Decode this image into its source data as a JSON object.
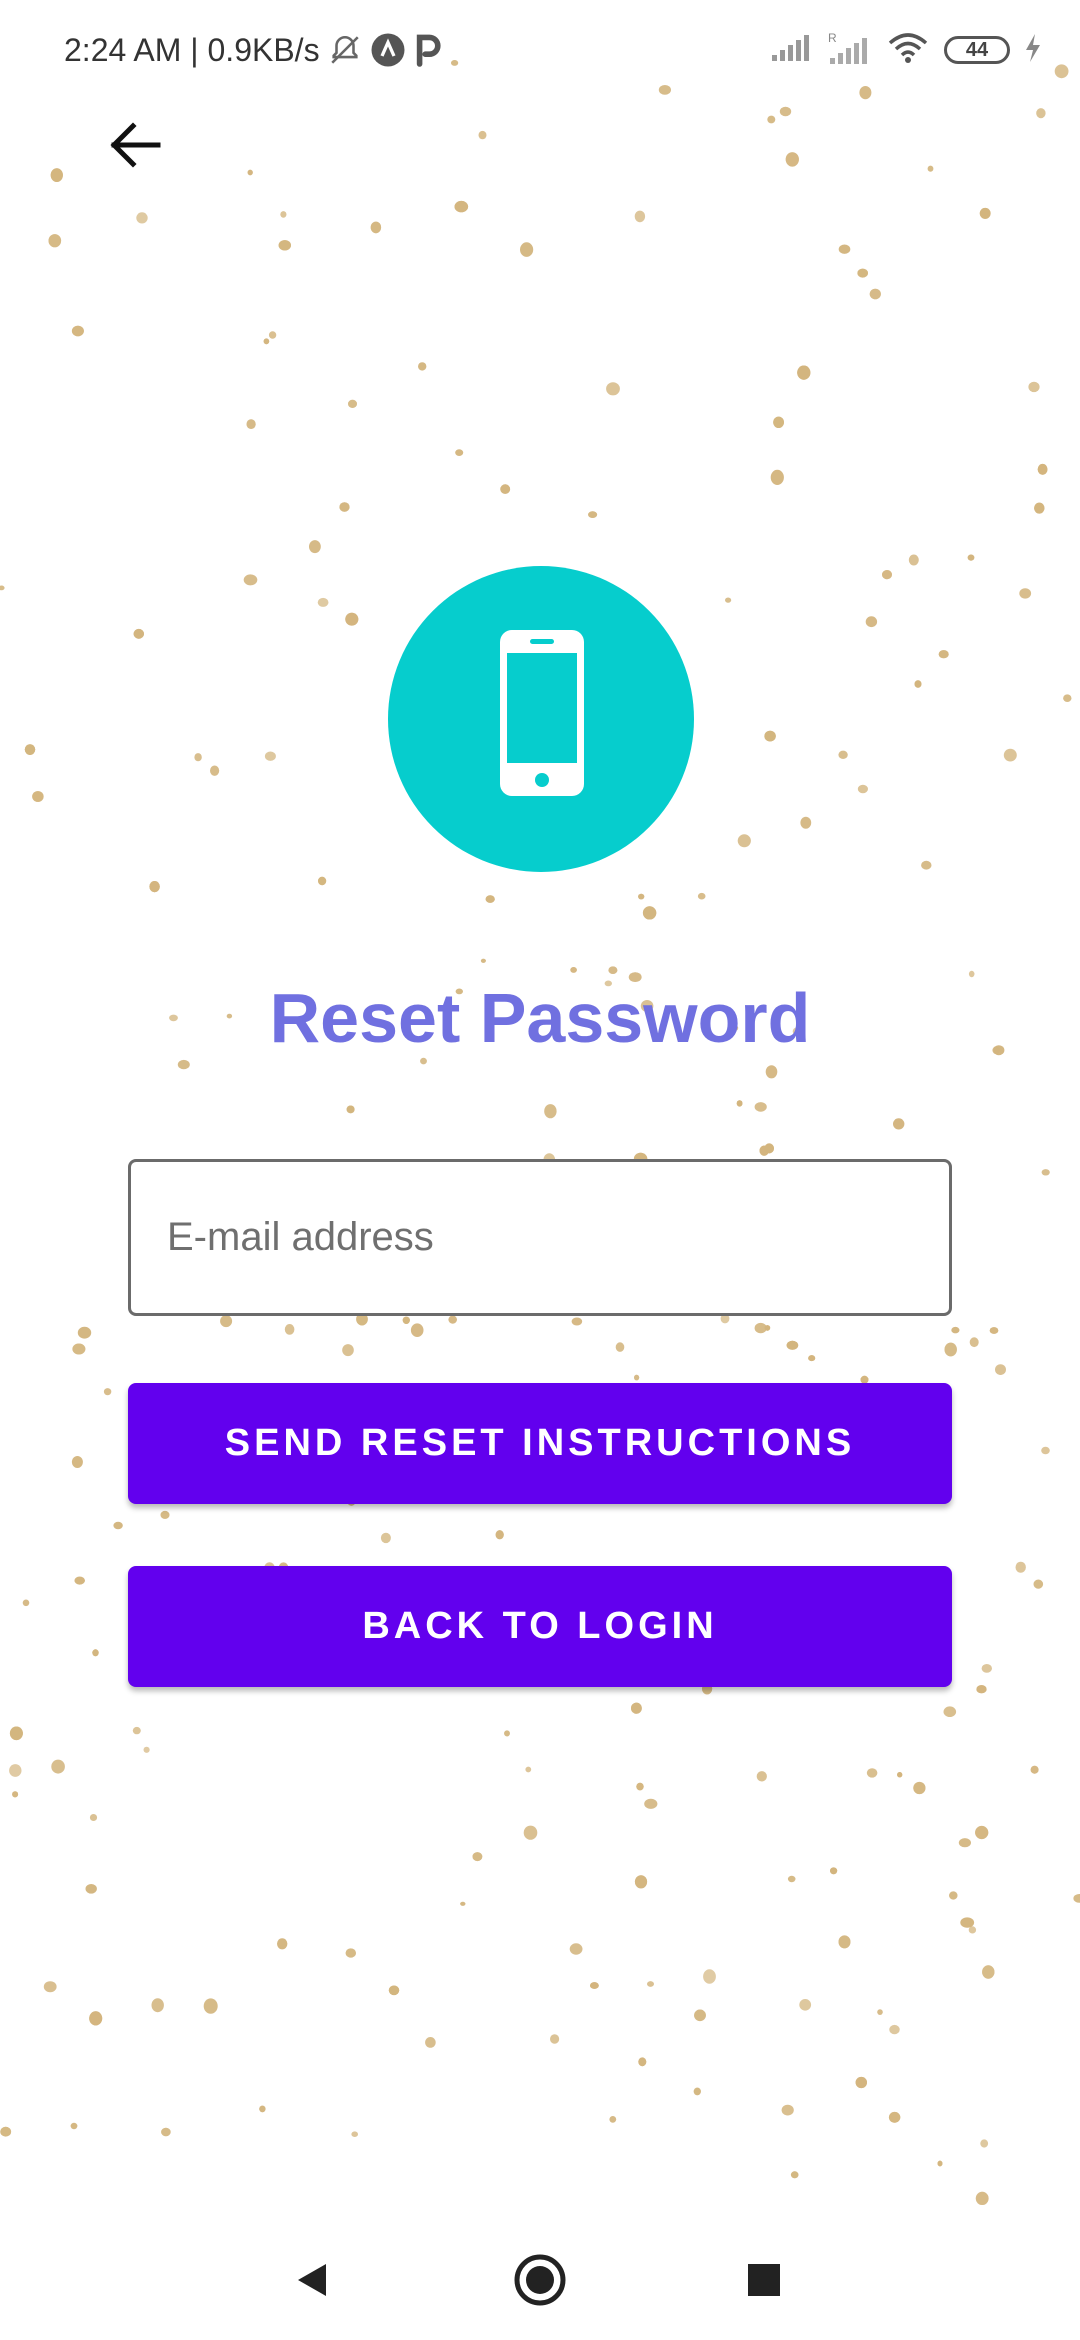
{
  "status_bar": {
    "time_speed": "2:24 AM | 0.9KB/s",
    "battery": "44",
    "icons": [
      "bell-off-icon",
      "android-icon",
      "parking-icon",
      "signal-icon",
      "signal-roaming-icon",
      "wifi-icon",
      "battery-icon",
      "charging-icon"
    ]
  },
  "header": {
    "back_icon": "arrow-left-icon"
  },
  "hero": {
    "icon": "smartphone-icon",
    "circle_color": "#06cdcd"
  },
  "title": "Reset Password",
  "email": {
    "placeholder": "E-mail address",
    "value": ""
  },
  "buttons": {
    "send": "SEND RESET INSTRUCTIONS",
    "back_to_login": "BACK TO LOGIN"
  },
  "colors": {
    "accent": "#6200ee",
    "title": "#7070e0",
    "dots": "#d3b57e"
  },
  "nav": {
    "icons": [
      "nav-back-icon",
      "nav-home-icon",
      "nav-recents-icon"
    ]
  }
}
